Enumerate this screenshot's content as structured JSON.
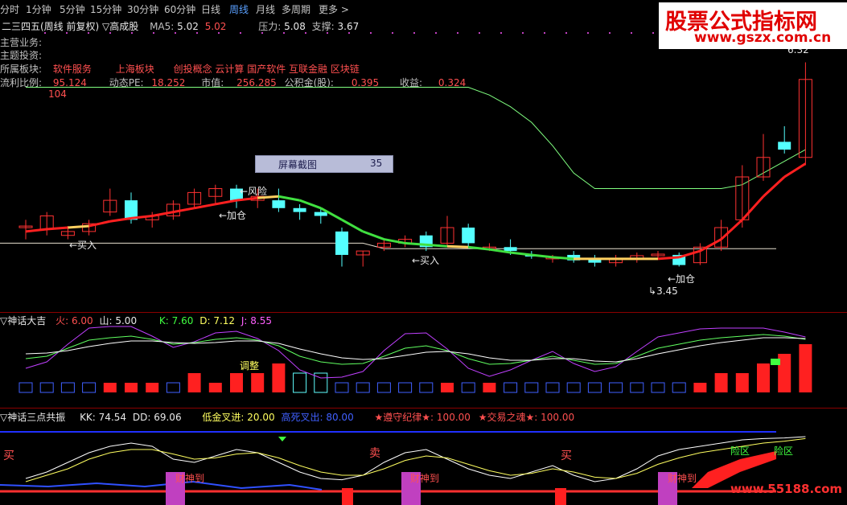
{
  "tabs": [
    "分时",
    "1分钟",
    "5分钟",
    "15分钟",
    "30分钟",
    "60分钟",
    "日线",
    "周线",
    "月线",
    "多周期",
    "更多 >"
  ],
  "active_tab": "周线",
  "header": {
    "title": "二三四五(周线 前复权) ▽高成股",
    "ma5_label": "MA5:",
    "ma5_a": "5.02",
    "ma5_b": "5.02",
    "pressure_label": "压力:",
    "pressure": "5.08",
    "support_label": "支撑:",
    "support": "3.67"
  },
  "info": {
    "main_business": "主营业务:",
    "theme": "主题投资:",
    "sector_label": "所属板块:",
    "sectors": [
      "软件服务",
      "上海板块",
      "创投概念 云计算 国产软件 互联金融 区块链"
    ],
    "pe_label": "流利比例:",
    "pe_val": "95.124",
    "pe_sub": "104",
    "dyn_pe_label": "动态PE:",
    "dyn_pe": "18.252",
    "mv_label": "市值:",
    "mv": "256.285",
    "fund_label": "公积金(股):",
    "fund": "0.395",
    "eps_label": "收益:",
    "eps": "0.324"
  },
  "screenshot_box": {
    "label": "屏幕截图",
    "value": "35"
  },
  "watermark": {
    "line1": "股票公式指标网",
    "line2": "www.gszx.com.cn",
    "bottom": "www.55188.com"
  },
  "annotations": {
    "risk": "←风险",
    "add1": "←加仓",
    "buy1": "←买入",
    "buy2": "←买入",
    "add2": "←加仓",
    "low": "3.45",
    "high": "6.32"
  },
  "sub1": {
    "title": "▽神话大吉",
    "fire_label": "火:",
    "fire": "6.00",
    "mountain_label": "山:",
    "mountain": "5.00",
    "k_label": "K:",
    "k": "7.60",
    "d_label": "D:",
    "d": "7.12",
    "j_label": "J:",
    "j": "8.55",
    "adjust": "调整"
  },
  "sub2": {
    "title": "▽神话三点共振",
    "kk_label": "KK:",
    "kk": "74.54",
    "dd_label": "DD:",
    "dd": "69.06",
    "low_gold_label": "低金叉进:",
    "low_gold": "20.00",
    "high_dead_label": "高死叉出:",
    "high_dead": "80.00",
    "discipline": "★遵守纪律★:",
    "discipline_val": "100.00",
    "soul": "★交易之魂★:",
    "soul_val": "100.00",
    "buy": "买",
    "sell": "卖",
    "caishen": "财神到",
    "risk_zone": "险区"
  },
  "colors": {
    "up": "#ff3232",
    "down": "#54ffff",
    "ma_up": "#ff2020",
    "ma_mid": "#ffd060",
    "ma_down": "#40e040",
    "line": "#e0e0e0"
  },
  "chart_data": {
    "type": "candlestick",
    "title": "二三四五(周线 前复权)",
    "ylim": [
      3.2,
      6.5
    ],
    "candles": [
      {
        "o": 4.2,
        "h": 4.3,
        "l": 4.05,
        "c": 4.22
      },
      {
        "o": 4.18,
        "h": 4.4,
        "l": 4.1,
        "c": 4.35
      },
      {
        "o": 4.1,
        "h": 4.22,
        "l": 4.05,
        "c": 4.15
      },
      {
        "o": 4.15,
        "h": 4.3,
        "l": 4.1,
        "c": 4.25
      },
      {
        "o": 4.4,
        "h": 4.7,
        "l": 4.35,
        "c": 4.55
      },
      {
        "o": 4.55,
        "h": 4.65,
        "l": 4.25,
        "c": 4.3
      },
      {
        "o": 4.3,
        "h": 4.4,
        "l": 4.2,
        "c": 4.35
      },
      {
        "o": 4.35,
        "h": 4.55,
        "l": 4.3,
        "c": 4.5
      },
      {
        "o": 4.5,
        "h": 4.7,
        "l": 4.45,
        "c": 4.65
      },
      {
        "o": 4.6,
        "h": 4.75,
        "l": 4.5,
        "c": 4.7
      },
      {
        "o": 4.7,
        "h": 4.75,
        "l": 4.45,
        "c": 4.55
      },
      {
        "o": 4.55,
        "h": 4.7,
        "l": 4.45,
        "c": 4.6
      },
      {
        "o": 4.55,
        "h": 4.7,
        "l": 4.4,
        "c": 4.45
      },
      {
        "o": 4.45,
        "h": 4.5,
        "l": 4.3,
        "c": 4.4
      },
      {
        "o": 4.4,
        "h": 4.45,
        "l": 4.25,
        "c": 4.35
      },
      {
        "o": 4.15,
        "h": 4.2,
        "l": 3.7,
        "c": 3.85
      },
      {
        "o": 3.85,
        "h": 3.9,
        "l": 3.7,
        "c": 3.9
      },
      {
        "o": 3.95,
        "h": 4.05,
        "l": 3.9,
        "c": 4.0
      },
      {
        "o": 4.0,
        "h": 4.1,
        "l": 3.95,
        "c": 4.05
      },
      {
        "o": 4.1,
        "h": 4.15,
        "l": 3.9,
        "c": 3.95
      },
      {
        "o": 4.0,
        "h": 4.35,
        "l": 3.95,
        "c": 4.2
      },
      {
        "o": 4.2,
        "h": 4.25,
        "l": 3.95,
        "c": 4.0
      },
      {
        "o": 3.95,
        "h": 4.0,
        "l": 3.9,
        "c": 3.95
      },
      {
        "o": 3.95,
        "h": 4.05,
        "l": 3.85,
        "c": 3.9
      },
      {
        "o": 3.85,
        "h": 3.9,
        "l": 3.8,
        "c": 3.83
      },
      {
        "o": 3.8,
        "h": 3.85,
        "l": 3.75,
        "c": 3.82
      },
      {
        "o": 3.85,
        "h": 3.9,
        "l": 3.75,
        "c": 3.78
      },
      {
        "o": 3.8,
        "h": 3.85,
        "l": 3.7,
        "c": 3.75
      },
      {
        "o": 3.75,
        "h": 3.85,
        "l": 3.7,
        "c": 3.8
      },
      {
        "o": 3.8,
        "h": 3.88,
        "l": 3.75,
        "c": 3.84
      },
      {
        "o": 3.84,
        "h": 3.9,
        "l": 3.8,
        "c": 3.86
      },
      {
        "o": 3.85,
        "h": 3.88,
        "l": 3.7,
        "c": 3.72
      },
      {
        "o": 3.75,
        "h": 4.0,
        "l": 3.72,
        "c": 3.95
      },
      {
        "o": 3.95,
        "h": 4.3,
        "l": 3.9,
        "c": 4.2
      },
      {
        "o": 4.3,
        "h": 5.0,
        "l": 4.2,
        "c": 4.85
      },
      {
        "o": 4.85,
        "h": 5.4,
        "l": 4.8,
        "c": 5.1
      },
      {
        "o": 5.3,
        "h": 5.5,
        "l": 5.15,
        "c": 5.2
      },
      {
        "o": 5.1,
        "h": 6.32,
        "l": 5.0,
        "c": 6.1
      }
    ],
    "ma": [
      4.15,
      4.18,
      4.2,
      4.22,
      4.28,
      4.32,
      4.35,
      4.4,
      4.45,
      4.5,
      4.55,
      4.58,
      4.6,
      4.55,
      4.45,
      4.3,
      4.15,
      4.05,
      4.0,
      3.98,
      3.96,
      3.95,
      3.92,
      3.88,
      3.85,
      3.82,
      3.8,
      3.8,
      3.8,
      3.8,
      3.8,
      3.82,
      3.9,
      4.05,
      4.3,
      4.6,
      4.85,
      5.02
    ],
    "upper": [
      4.0,
      4.0,
      4.0,
      4.0,
      4.0,
      4.0,
      4.0,
      4.0,
      4.0,
      4.0,
      4.0,
      4.0,
      4.0,
      4.0,
      4.0,
      4.0,
      4.0,
      3.93,
      3.93,
      3.93,
      3.93,
      3.93,
      3.93,
      3.93,
      3.93,
      3.93,
      3.93,
      3.93,
      3.93,
      3.93,
      3.93,
      3.93
    ],
    "green_line": [
      6.0,
      6.0,
      6.0,
      6.0,
      6.0,
      6.0,
      6.0,
      6.0,
      6.0,
      6.0,
      6.0,
      6.0,
      6.0,
      6.0,
      6.0,
      6.0,
      6.0,
      6.0,
      6.0,
      6.0,
      6.0,
      6.0,
      5.9,
      5.75,
      5.55,
      5.25,
      4.9,
      4.7,
      4.7,
      4.7,
      4.7,
      4.7,
      4.7,
      4.7,
      4.75,
      4.9,
      5.05,
      5.2
    ],
    "sub1_bars": [
      -1,
      -1,
      -1,
      -1,
      1,
      1,
      1,
      -1,
      2,
      1,
      2,
      2,
      3,
      -2,
      -2,
      -1,
      -1,
      -1,
      -1,
      -1,
      1,
      -1,
      1,
      -1,
      -1,
      -1,
      -1,
      -1,
      -1,
      -1,
      -1,
      -1,
      1,
      2,
      2,
      3,
      4,
      5
    ],
    "sub1_k": [
      5.2,
      5.5,
      6.5,
      7.5,
      7.8,
      8.0,
      7.6,
      7.0,
      7.2,
      7.6,
      7.8,
      7.5,
      6.8,
      5.5,
      4.8,
      4.5,
      4.6,
      5.5,
      6.5,
      6.8,
      6.2,
      5.2,
      4.5,
      4.6,
      5.0,
      5.5,
      5.0,
      4.5,
      4.6,
      5.5,
      6.5,
      7.0,
      7.5,
      7.8,
      8.0,
      8.2,
      8.0,
      7.6
    ],
    "sub1_d": [
      5.8,
      5.9,
      6.2,
      6.7,
      7.1,
      7.4,
      7.4,
      7.2,
      7.1,
      7.2,
      7.4,
      7.4,
      7.1,
      6.4,
      5.8,
      5.3,
      5.1,
      5.2,
      5.6,
      6.0,
      6.1,
      5.8,
      5.3,
      5.0,
      5.0,
      5.2,
      5.2,
      4.9,
      4.8,
      5.2,
      5.8,
      6.3,
      6.8,
      7.2,
      7.5,
      7.8,
      7.8,
      7.7
    ],
    "sub1_j": [
      4.0,
      4.8,
      7.0,
      9.0,
      9.2,
      9.2,
      8.0,
      6.6,
      7.3,
      8.4,
      8.6,
      7.7,
      6.2,
      3.8,
      2.8,
      2.9,
      3.6,
      6.2,
      8.3,
      8.4,
      6.4,
      4.0,
      3.0,
      3.8,
      5.0,
      6.1,
      4.6,
      3.6,
      4.2,
      6.1,
      7.9,
      8.4,
      8.9,
      9.0,
      9.0,
      9.0,
      8.5,
      7.9
    ],
    "sub2_white": [
      30,
      40,
      55,
      70,
      80,
      85,
      80,
      60,
      55,
      65,
      75,
      70,
      55,
      40,
      30,
      28,
      35,
      55,
      70,
      75,
      60,
      45,
      35,
      30,
      40,
      50,
      35,
      25,
      30,
      45,
      65,
      75,
      80,
      85,
      90,
      92,
      93,
      95
    ],
    "sub2_yellow": [
      25,
      35,
      45,
      60,
      70,
      75,
      75,
      68,
      60,
      62,
      68,
      70,
      62,
      50,
      40,
      35,
      35,
      45,
      58,
      65,
      62,
      52,
      42,
      35,
      38,
      45,
      40,
      32,
      30,
      38,
      52,
      62,
      70,
      75,
      80,
      85,
      88,
      92
    ]
  }
}
